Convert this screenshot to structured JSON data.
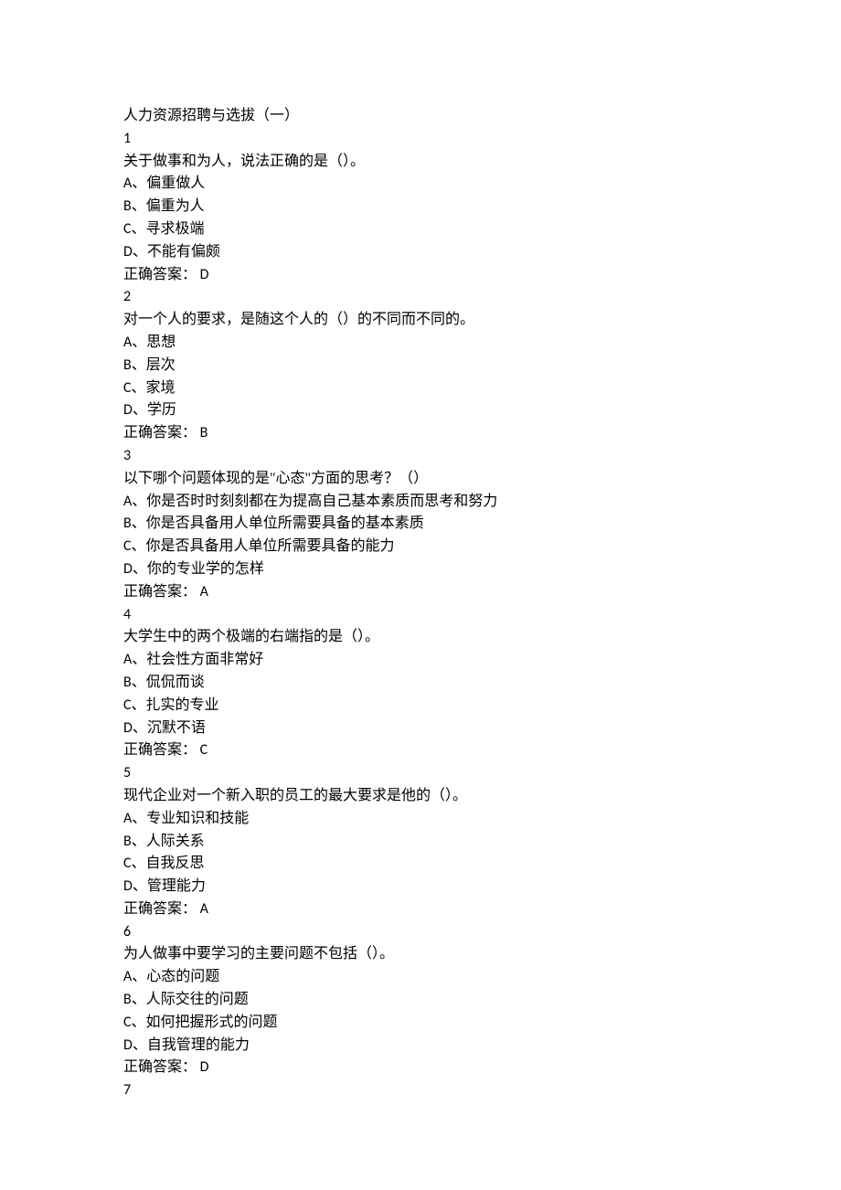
{
  "title": "人力资源招聘与选拔（一）",
  "answer_prefix": "正确答案：",
  "questions": [
    {
      "number": "1",
      "prompt": "关于做事和为人，说法正确的是（）。",
      "options": [
        {
          "label": "A、",
          "text": "偏重做人"
        },
        {
          "label": "B、",
          "text": "偏重为人"
        },
        {
          "label": "C、",
          "text": "寻求极端"
        },
        {
          "label": "D、",
          "text": "不能有偏颇"
        }
      ],
      "answer": "D"
    },
    {
      "number": "2",
      "prompt": "对一个人的要求，是随这个人的（）的不同而不同的。",
      "options": [
        {
          "label": "A、",
          "text": "思想"
        },
        {
          "label": "B、",
          "text": "层次"
        },
        {
          "label": "C、",
          "text": "家境"
        },
        {
          "label": "D、",
          "text": "学历"
        }
      ],
      "answer": "B"
    },
    {
      "number": "3",
      "prompt": "以下哪个问题体现的是\"心态\"方面的思考？（）",
      "options": [
        {
          "label": "A、",
          "text": "你是否时时刻刻都在为提高自己基本素质而思考和努力"
        },
        {
          "label": "B、",
          "text": "你是否具备用人单位所需要具备的基本素质"
        },
        {
          "label": "C、",
          "text": "你是否具备用人单位所需要具备的能力"
        },
        {
          "label": "D、",
          "text": "你的专业学的怎样"
        }
      ],
      "answer": "A"
    },
    {
      "number": "4",
      "prompt": "大学生中的两个极端的右端指的是（）。",
      "options": [
        {
          "label": "A、",
          "text": "社会性方面非常好"
        },
        {
          "label": "B、",
          "text": "侃侃而谈"
        },
        {
          "label": "C、",
          "text": "扎实的专业"
        },
        {
          "label": "D、",
          "text": "沉默不语"
        }
      ],
      "answer": "C"
    },
    {
      "number": "5",
      "prompt": "现代企业对一个新入职的员工的最大要求是他的（）。",
      "options": [
        {
          "label": "A、",
          "text": "专业知识和技能"
        },
        {
          "label": "B、",
          "text": "人际关系"
        },
        {
          "label": "C、",
          "text": "自我反思"
        },
        {
          "label": "D、",
          "text": "管理能力"
        }
      ],
      "answer": "A"
    },
    {
      "number": "6",
      "prompt": "为人做事中要学习的主要问题不包括（）。",
      "options": [
        {
          "label": "A、",
          "text": "心态的问题"
        },
        {
          "label": "B、",
          "text": "人际交往的问题"
        },
        {
          "label": "C、",
          "text": "如何把握形式的问题"
        },
        {
          "label": "D、",
          "text": "自我管理的能力"
        }
      ],
      "answer": "D"
    },
    {
      "number": "7"
    }
  ]
}
